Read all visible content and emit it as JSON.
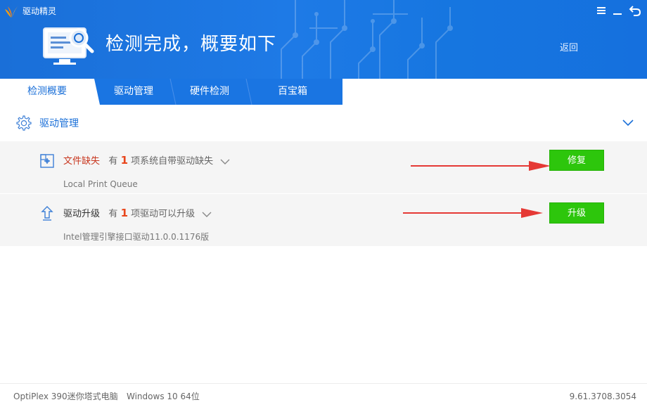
{
  "app": {
    "title": "驱动精灵"
  },
  "header": {
    "title": "检测完成，概要如下",
    "back_label": "返回"
  },
  "window_controls": {
    "menu_icon": "menu-icon",
    "minimize_icon": "minimize-icon",
    "close_icon": "back-arrow-icon"
  },
  "tabs": [
    {
      "label": "检测概要",
      "active": true
    },
    {
      "label": "驱动管理",
      "active": false
    },
    {
      "label": "硬件检测",
      "active": false
    },
    {
      "label": "百宝箱",
      "active": false
    }
  ],
  "section": {
    "title": "驱动管理",
    "icon": "gear-icon",
    "toggle_icon": "chevron-down-icon"
  },
  "rows": [
    {
      "label": "文件缺失",
      "prefix": "有",
      "count": "1",
      "suffix": "项系统自带驱动缺失",
      "detail": "Local Print Queue",
      "button": "修复",
      "icon": "driver-missing-icon"
    },
    {
      "label": "驱动升级",
      "prefix": "有",
      "count": "1",
      "suffix": "项驱动可以升级",
      "detail": "Intel管理引擎接口驱动11.0.0.1176版",
      "button": "升级",
      "icon": "upgrade-icon"
    }
  ],
  "footer": {
    "model": "OptiPlex 390迷你塔式电脑",
    "os": "Windows 10 64位",
    "version": "9.61.3708.3054"
  },
  "colors": {
    "header_blue": "#1a6fd8",
    "tab_blue": "#1a75e2",
    "button_green": "#2dc60c",
    "arrow_red": "#e53935",
    "warning_red": "#c8371f"
  }
}
